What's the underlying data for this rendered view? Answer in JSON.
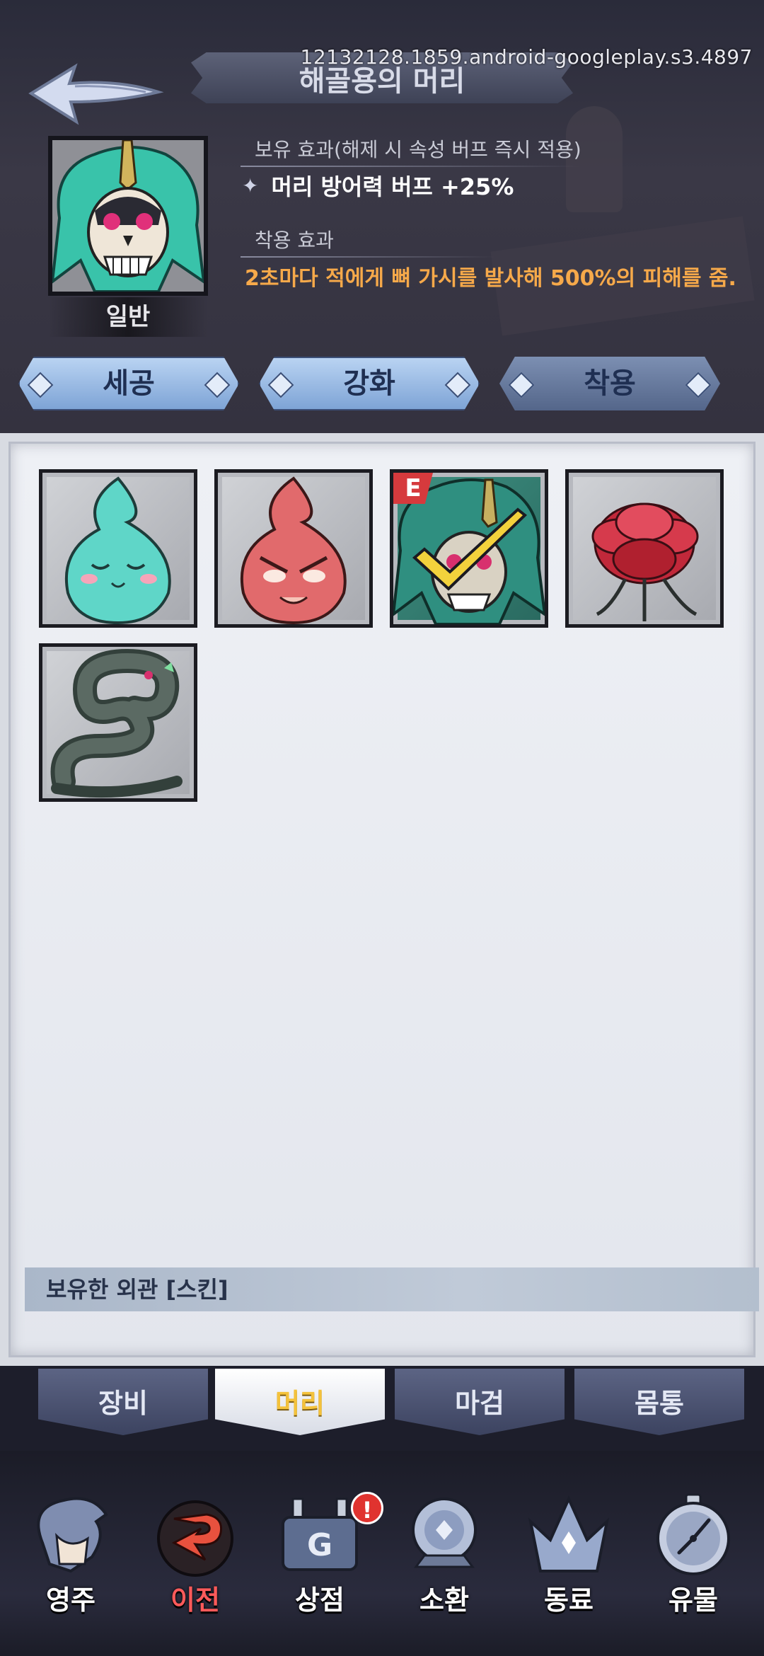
{
  "version_text": "12132128.1859.android-googleplay.s3.4897",
  "item": {
    "title": "해골용의 머리",
    "rarity": "일반",
    "owned_effect_label": "보유 효과(해제 시 속성 버프 즉시 적용)",
    "owned_effect_value": "머리 방어력 버프  +25%",
    "equip_effect_label": "착용 효과",
    "equip_effect_text": "2초마다 적에게 뼈 가시를 발사해 500%의 피해를 줌."
  },
  "actions": {
    "refine_label": "세공",
    "enhance_label": "강화",
    "equip_label": "착용"
  },
  "inventory": {
    "equipped_badge": "E",
    "items": [
      {
        "icon": "blue-flame-slime-icon"
      },
      {
        "icon": "red-flame-slime-icon"
      },
      {
        "icon": "skull-dragon-head-icon",
        "equipped": true,
        "selected": true
      },
      {
        "icon": "red-spider-lily-icon"
      },
      {
        "icon": "serpent-icon"
      }
    ],
    "skins_header": "보유한 외관 [스킨]"
  },
  "tabs": [
    {
      "label": "장비",
      "active": false
    },
    {
      "label": "머리",
      "active": true
    },
    {
      "label": "마검",
      "active": false
    },
    {
      "label": "몸통",
      "active": false
    }
  ],
  "nav": {
    "notify_badge": "!",
    "items": [
      {
        "label": "영주",
        "icon": "lord-icon",
        "active": false
      },
      {
        "label": "이전",
        "icon": "return-icon",
        "active": true
      },
      {
        "label": "상점",
        "icon": "shop-icon",
        "active": false
      },
      {
        "label": "소환",
        "icon": "summon-orb-icon",
        "active": false
      },
      {
        "label": "동료",
        "icon": "companion-crown-icon",
        "active": false
      },
      {
        "label": "유물",
        "icon": "relic-compass-icon",
        "active": false
      }
    ]
  },
  "colors": {
    "equip_effect": "#f6a94a",
    "active_nav": "#ff5a5a",
    "active_tab": "#f4c23c",
    "badge": "#d63a3d"
  }
}
